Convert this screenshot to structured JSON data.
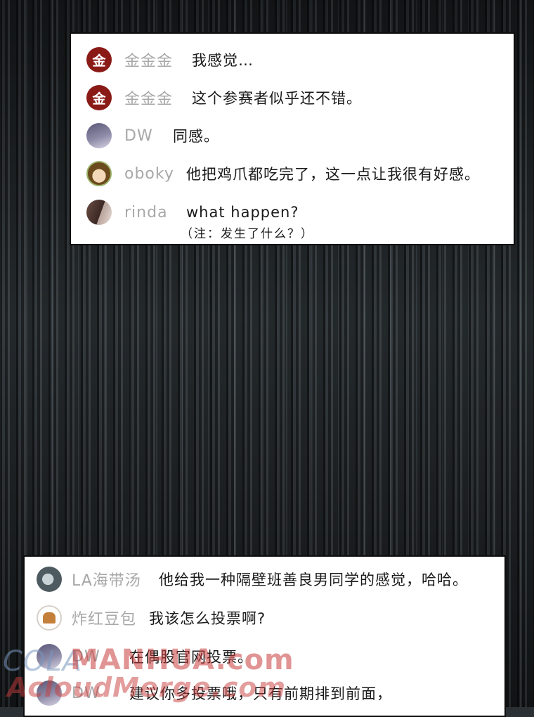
{
  "top_chat": [
    {
      "name": "金金金",
      "text": "我感觉…",
      "avatar": "gold-coin-avatar",
      "avatar_char": "金"
    },
    {
      "name": "金金金",
      "text": "这个参赛者似乎还不错。",
      "avatar": "gold-coin-avatar",
      "avatar_char": "金"
    },
    {
      "name": "DW",
      "text": "同感。",
      "avatar": "dw-avatar"
    },
    {
      "name": "oboky",
      "text": "他把鸡爪都吃完了，这一点让我很有好感。",
      "avatar": "oboky-avatar"
    },
    {
      "name": "rinda",
      "text": "what happen?",
      "avatar": "rinda-avatar",
      "note": "（注：发生了什么？）"
    }
  ],
  "bottom_chat": [
    {
      "name": "LA海带汤",
      "text": "他给我一种隔壁班善良男同学的感觉，哈哈。",
      "avatar": "la-avatar"
    },
    {
      "name": "炸红豆包",
      "text": "我该怎么投票啊?",
      "avatar": "bread-avatar"
    },
    {
      "name": "DW",
      "text": "在偶股官网投票。",
      "avatar": "dw-avatar"
    },
    {
      "name": "DW",
      "text": "建议你多投票哦，只有前期排到前面，",
      "avatar": "dw-avatar"
    }
  ],
  "watermarks": [
    "COLA",
    "MANHUA.com",
    "AcloudMerge.com"
  ],
  "colors": {
    "panel_bg": "#ffffff",
    "name_gray": "#a8a8a8",
    "gold_avatar": "#8a1a16"
  }
}
